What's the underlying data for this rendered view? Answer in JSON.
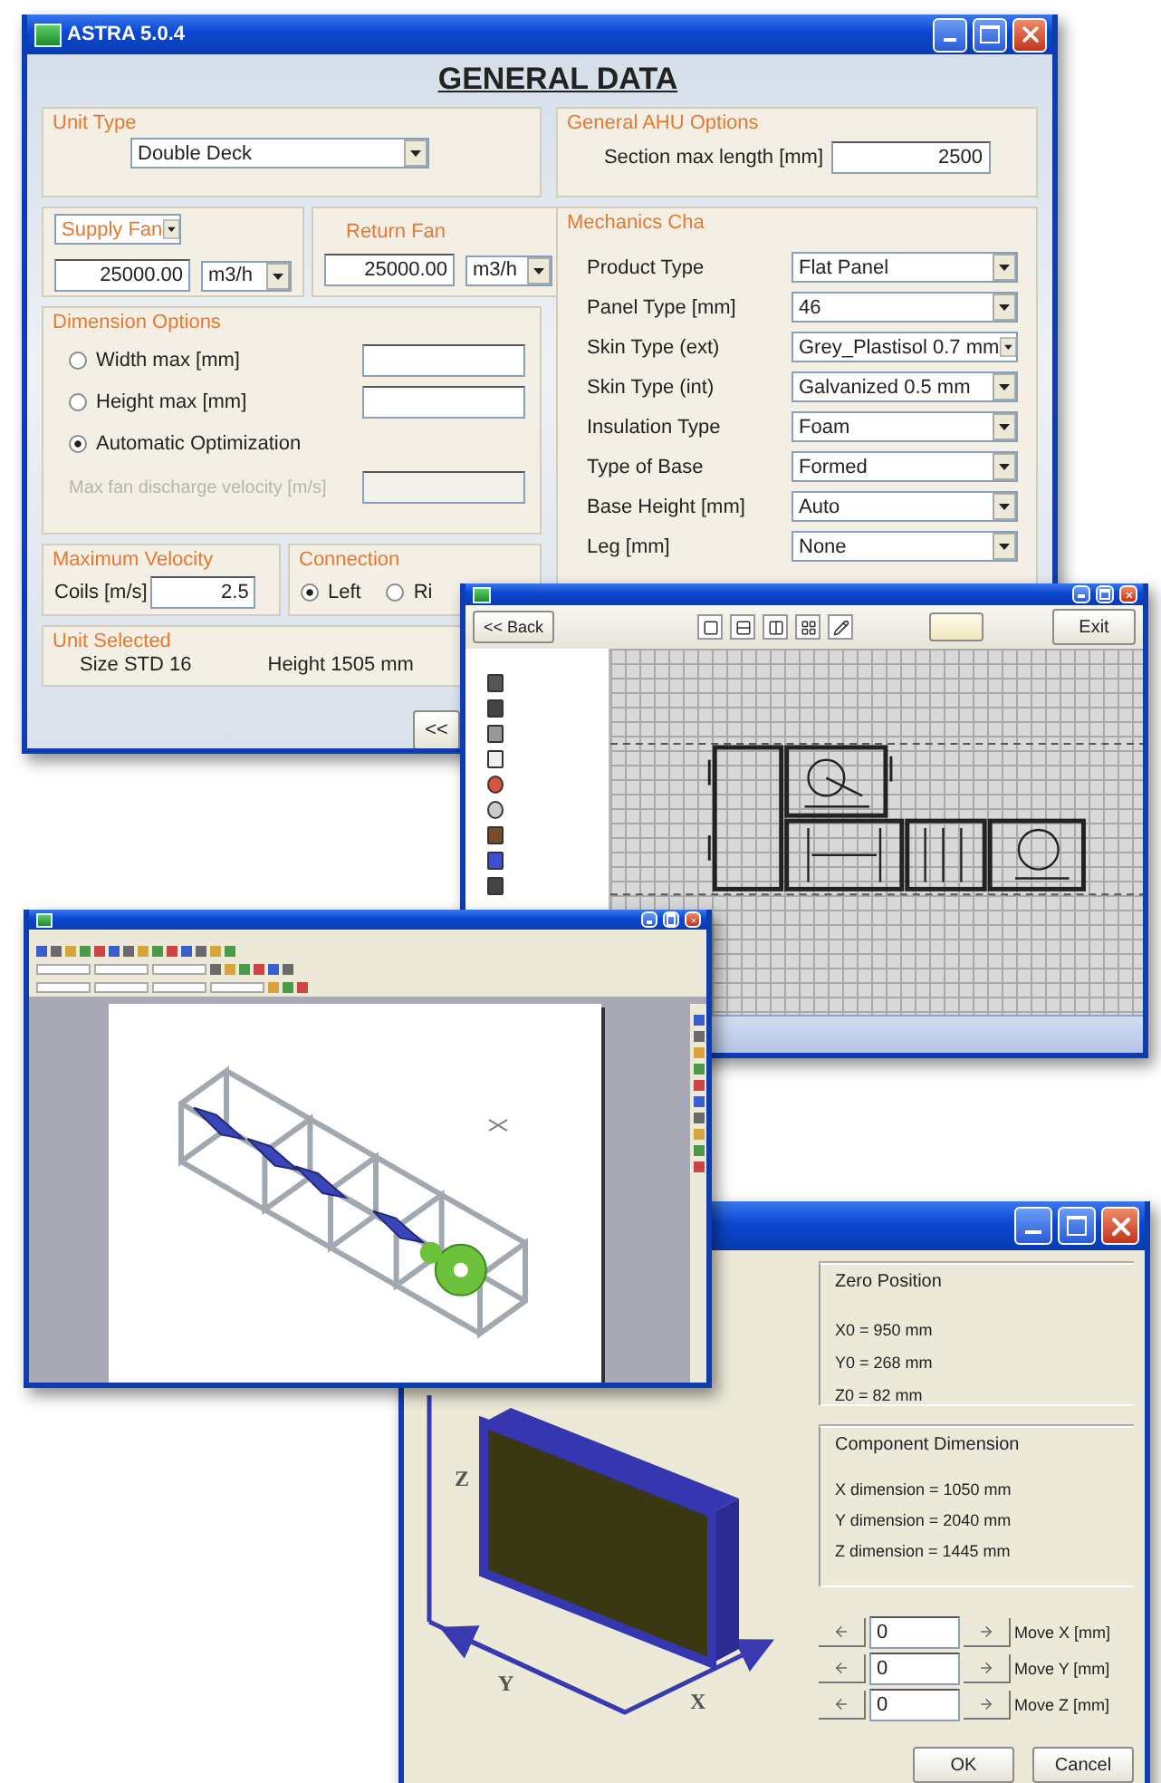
{
  "general_window": {
    "title": "ASTRA 5.0.4",
    "heading": "GENERAL DATA",
    "unit_type": {
      "legend": "Unit Type",
      "value": "Double Deck"
    },
    "supply_fan": {
      "legend": "Supply Fan",
      "value": "25000.00",
      "unit": "m3/h"
    },
    "return_fan": {
      "legend": "Return Fan",
      "value": "25000.00",
      "unit": "m3/h"
    },
    "dimension_options": {
      "legend": "Dimension Options",
      "options": [
        {
          "label": "Width max [mm]",
          "selected": false,
          "has_field": true
        },
        {
          "label": "Height max [mm]",
          "selected": false,
          "has_field": true
        },
        {
          "label": "Automatic Optimization",
          "selected": true,
          "has_field": false
        }
      ],
      "discharge": {
        "label": "Max fan discharge velocity [m/s]",
        "disabled": true
      }
    },
    "max_velocity": {
      "legend": "Maximum Velocity",
      "label": "Coils [m/s]",
      "value": "2.5"
    },
    "connection": {
      "legend": "Connection",
      "options": [
        {
          "label": "Left",
          "selected": true
        },
        {
          "label": "Ri",
          "selected": false
        }
      ]
    },
    "unit_selected": {
      "legend": "Unit Selected",
      "items": [
        "Size STD 16",
        "Height 1505 mm"
      ]
    },
    "back_button": "<<",
    "ahu_options": {
      "legend": "General AHU Options",
      "label": "Section max length [mm]",
      "value": "2500"
    },
    "mechanics": {
      "legend": "Mechanics Cha",
      "rows": [
        {
          "label": "Product Type",
          "value": "Flat Panel"
        },
        {
          "label": "Panel Type [mm]",
          "value": "46"
        },
        {
          "label": "Skin Type (ext)",
          "value": "Grey_Plastisol 0.7 mm"
        },
        {
          "label": "Skin Type (int)",
          "value": "Galvanized 0.5 mm"
        },
        {
          "label": "Insulation Type",
          "value": "Foam"
        },
        {
          "label": "Type of Base",
          "value": "Formed"
        },
        {
          "label": "Base Height [mm]",
          "value": "Auto"
        },
        {
          "label": "Leg [mm]",
          "value": "None"
        }
      ]
    }
  },
  "layout_window": {
    "back_button": "<< Back",
    "exit_button": "Exit"
  },
  "position_window": {
    "zero_position": {
      "legend": "Zero Position",
      "lines": [
        "X0 = 950 mm",
        "Y0 = 268 mm",
        "Z0 = 82 mm"
      ]
    },
    "component_dimension": {
      "legend": "Component Dimension",
      "lines": [
        "X dimension = 1050 mm",
        "Y dimension = 2040 mm",
        "Z dimension = 1445 mm"
      ]
    },
    "moves": [
      {
        "value": "0",
        "label": "Move X [mm]"
      },
      {
        "value": "0",
        "label": "Move Y [mm]"
      },
      {
        "value": "0",
        "label": "Move Z [mm]"
      }
    ],
    "axis_labels": {
      "z": "Z",
      "y": "Y",
      "x": "X"
    },
    "ok_button": "OK",
    "cancel_button": "Cancel"
  }
}
